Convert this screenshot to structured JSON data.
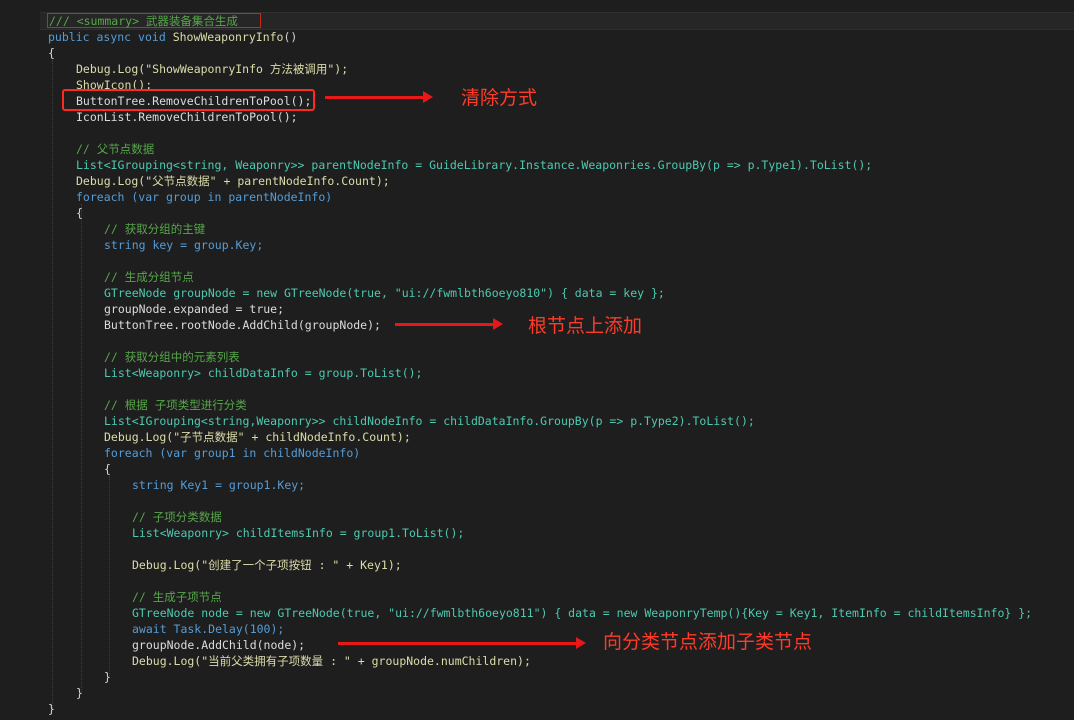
{
  "code": {
    "summary": "/// <summary> 武器装备集合生成",
    "method_signature": [
      "public",
      "async",
      "void",
      "ShowWeaponryInfo",
      "()"
    ],
    "lines": {
      "open_brace": "{",
      "debug_log_1": "Debug.Log(\"ShowWeaponryInfo 方法被调用\");",
      "show_icon": "ShowIcon();",
      "button_tree_clear": "ButtonTree.RemoveChildrenToPool();",
      "icon_list_clear": "IconList.RemoveChildrenToPool();",
      "comment_parent": "// 父节点数据",
      "parent_node_info": "List<IGrouping<string, Weaponry>> parentNodeInfo = GuideLibrary.Instance.Weaponries.GroupBy(p => p.Type1).ToList();",
      "debug_log_parent": "Debug.Log(\"父节点数据\" + parentNodeInfo.Count);",
      "foreach_outer": "foreach (var group in parentNodeInfo)",
      "open_brace_2": "{",
      "comment_get_key": "// 获取分组的主键",
      "string_key": "string key = group.Key;",
      "comment_gen_group": "// 生成分组节点",
      "group_node_new": "GTreeNode groupNode = new GTreeNode(true, \"ui://fwmlbth6oeyo810\") { data = key };",
      "group_node_expanded": "groupNode.expanded = true;",
      "root_add_child": "ButtonTree.rootNode.AddChild(groupNode);",
      "comment_get_elements": "// 获取分组中的元素列表",
      "child_data_info": "List<Weaponry> childDataInfo = group.ToList();",
      "comment_by_type": "// 根据 子项类型进行分类",
      "child_node_info": "List<IGrouping<string,Weaponry>> childNodeInfo = childDataInfo.GroupBy(p => p.Type2).ToList();",
      "debug_log_child": "Debug.Log(\"子节点数据\" + childNodeInfo.Count);",
      "foreach_inner": "foreach (var group1 in childNodeInfo)",
      "open_brace_3": "{",
      "string_key1": "string Key1 = group1.Key;",
      "comment_child_data": "// 子项分类数据",
      "child_items_info": "List<Weaponry> childItemsInfo = group1.ToList();",
      "debug_log_created": "Debug.Log(\"创建了一个子项按钮 : \" + Key1);",
      "comment_gen_child": "// 生成子项节点",
      "child_node_new": "GTreeNode node = new GTreeNode(true, \"ui://fwmlbth6oeyo811\") { data = new WeaponryTemp(){Key = Key1, ItemInfo = childItemsInfo} };",
      "await_delay": "await Task.Delay(100);",
      "group_add_child": "groupNode.AddChild(node);",
      "debug_log_count": "Debug.Log(\"当前父类拥有子项数量 : \" + groupNode.numChildren);",
      "close_brace_3": "}",
      "close_brace_2": "}",
      "close_brace_1": "}"
    }
  },
  "annotations": {
    "clear_method": "清除方式",
    "root_add": "根节点上添加",
    "child_add": "向分类节点添加子类节点"
  },
  "colors": {
    "background": "#1e1e1e",
    "keyword": "#569cd6",
    "type": "#4ec9b0",
    "method": "#dcdcaa",
    "string": "#d69d85",
    "comment": "#57a64a",
    "annotation_red": "#ff3b2a"
  }
}
